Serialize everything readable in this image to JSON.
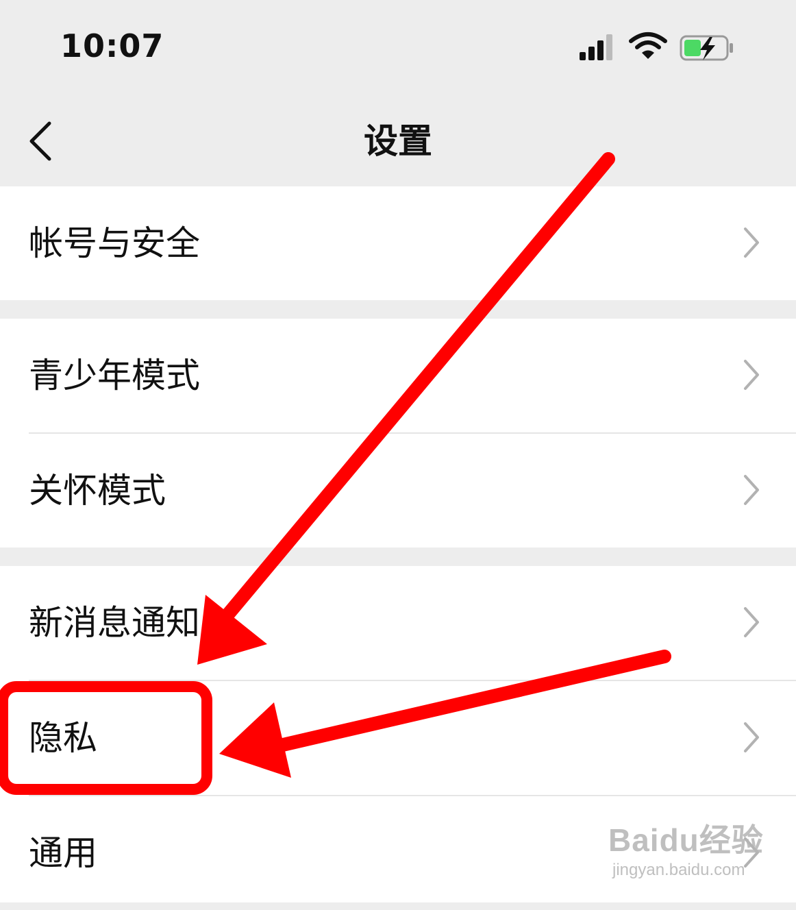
{
  "status_bar": {
    "time": "10:07",
    "icons": [
      "signal-icon",
      "wifi-icon",
      "battery-charging-icon"
    ],
    "battery_color": "#4cd964"
  },
  "nav": {
    "title": "设置",
    "back_icon": "chevron-left-icon"
  },
  "groups": [
    {
      "items": [
        {
          "label": "帐号与安全"
        }
      ]
    },
    {
      "items": [
        {
          "label": "青少年模式"
        },
        {
          "label": "关怀模式"
        }
      ]
    },
    {
      "items": [
        {
          "label": "新消息通知"
        },
        {
          "label": "隐私"
        },
        {
          "label": "通用"
        }
      ]
    }
  ],
  "annotation": {
    "color": "#ff0000",
    "highlighted_item": "隐私"
  },
  "watermark": {
    "brand": "Baidu经验",
    "url": "jingyan.baidu.com"
  }
}
